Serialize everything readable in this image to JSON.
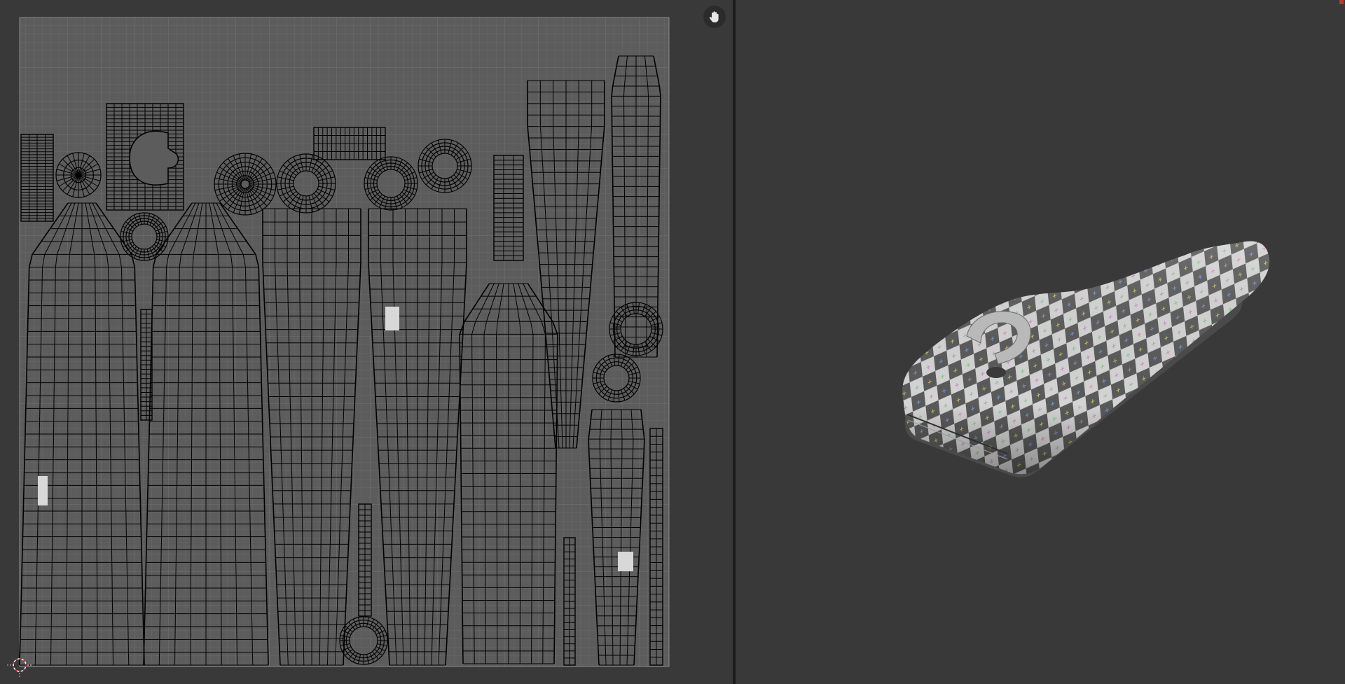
{
  "app": {
    "left_editor": "uv-editor",
    "right_editor": "3d-viewport"
  },
  "uv_editor": {
    "grid_color": "#606060",
    "wire_color": "#000000",
    "image_bg": "#5c5c5c",
    "nav_icon": "hand-pan-icon",
    "islands": [
      "strip-a",
      "radial-disc-a",
      "block-c-shape",
      "radial-disc-b",
      "radial-disc-c",
      "capsule",
      "ring-a",
      "radial-disc-d",
      "handle-arm",
      "strip-b",
      "long-shell-left-1",
      "ring-b",
      "long-shell-left-2",
      "long-shell-mid-1",
      "long-shell-mid-2",
      "long-shell-front",
      "bottle-shell",
      "tall-shell",
      "key-shell",
      "strip-c",
      "strip-d",
      "strip-e",
      "ring-c"
    ]
  },
  "viewport_3d": {
    "object": "checker-textured-model",
    "checker_light": "#d4d4d4",
    "checker_dark": "#5a5a5a"
  },
  "accent": "#c0392b"
}
